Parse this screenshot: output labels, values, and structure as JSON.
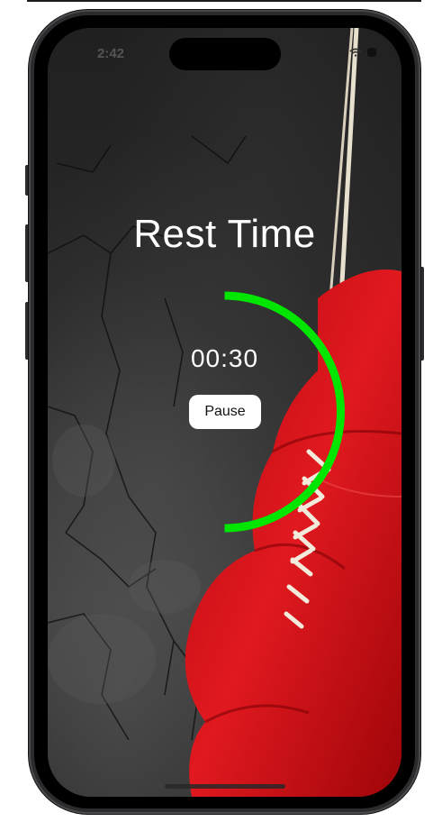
{
  "status_bar": {
    "time": "2:42",
    "icons": [
      "wifi-icon",
      "battery-icon"
    ]
  },
  "screen": {
    "title": "Rest Time",
    "timer": "00:30",
    "pause_label": "Pause",
    "progress_fraction": 0.5
  },
  "colors": {
    "ring": "#00e600",
    "title_text": "#ffffff",
    "button_bg": "#ffffff",
    "glove": "#d8181c"
  },
  "background_image": "boxing-glove-on-concrete-wall"
}
